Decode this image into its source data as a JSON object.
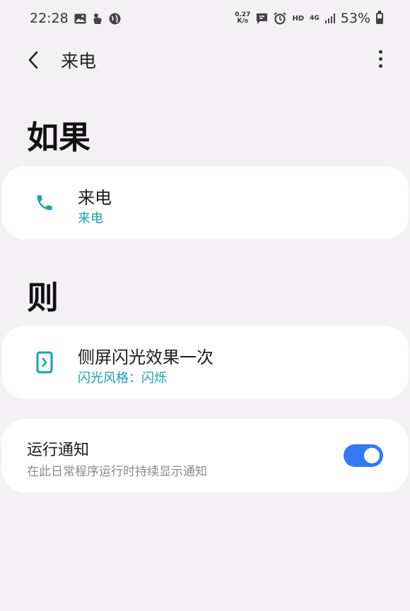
{
  "status_bar": {
    "time": "22:28",
    "net_speed_value": "0.27",
    "net_speed_unit": "K/s",
    "hd": "HD",
    "network": "4G",
    "battery": "53%",
    "icons": [
      "image-icon",
      "hand-icon",
      "globe-icon",
      "message-icon",
      "alarm-icon",
      "signal-icon",
      "battery-icon"
    ]
  },
  "app_bar": {
    "title": "来电"
  },
  "if_section": {
    "title": "如果",
    "card": {
      "icon": "phone-icon",
      "title": "来电",
      "subtitle": "来电"
    }
  },
  "then_section": {
    "title": "则",
    "card": {
      "icon": "edge-lighting-icon",
      "title": "侧屏闪光效果一次",
      "subtitle": "闪光风格：闪烁"
    }
  },
  "run_notification": {
    "title": "运行通知",
    "description": "在此日常程序运行时持续显示通知",
    "enabled": true
  },
  "colors": {
    "background": "#f4f1f5",
    "accent": "#16a2b2",
    "toggle_on": "#3479f5"
  }
}
